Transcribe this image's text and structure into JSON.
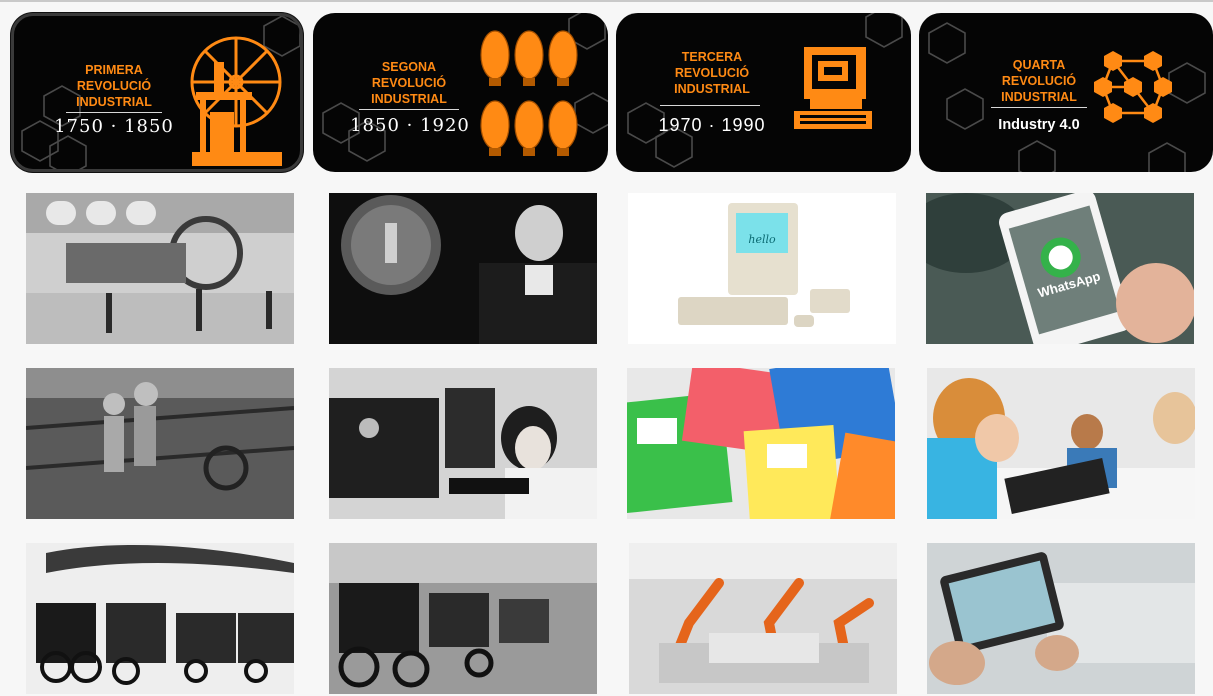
{
  "revolutions": [
    {
      "title_lines": [
        "PRIMERA",
        "REVOLUCIÓ",
        "INDUSTRIAL"
      ],
      "years": "1750 · 1850",
      "icon": "steam-engine-icon"
    },
    {
      "title_lines": [
        "SEGONA",
        "REVOLUCIÓ",
        "INDUSTRIAL"
      ],
      "years": "1850 · 1920",
      "icon": "light-bulb-icon"
    },
    {
      "title_lines": [
        "TERCERA",
        "REVOLUCIÓ",
        "INDUSTRIAL"
      ],
      "years": "1970 · 1990",
      "icon": "computer-icon"
    },
    {
      "title_lines": [
        "QUARTA",
        "REVOLUCIÓ",
        "INDUSTRIAL"
      ],
      "years": "Industry 4.0",
      "icon": "hexagon-network-icon"
    }
  ],
  "photos": {
    "row1": [
      "steam engine exhibition hall",
      "Edison with giant light bulb",
      "Apple Macintosh computer",
      "smartphone showing WhatsApp"
    ],
    "row1_overlay": {
      "mac_screen": "hello",
      "phone_app": "WhatsApp"
    },
    "row2": [
      "children working at spinning machines",
      "woman telegraph operator",
      "colourful floppy disks",
      "children using a tablet"
    ],
    "row3": [
      "early steam locomotive train",
      "automobile assembly line",
      "robotic car factory",
      "tablet controlling factory"
    ]
  },
  "colors": {
    "accent": "#ff8a14",
    "card_bg": "#050505",
    "page_bg": "#f7f7f7"
  }
}
